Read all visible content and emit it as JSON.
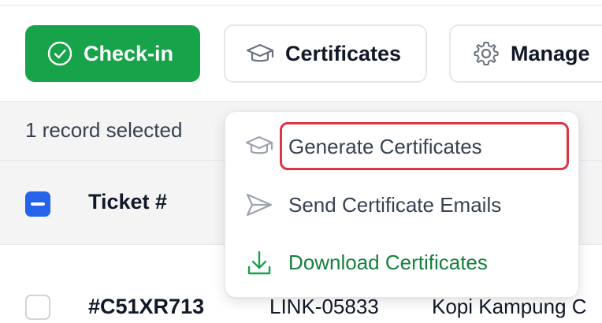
{
  "toolbar": {
    "checkin_label": "Check-in",
    "certificates_label": "Certificates",
    "manage_label": "Manage"
  },
  "selection": {
    "text": "1 record selected"
  },
  "table": {
    "header": {
      "ticket": "Ticket #"
    },
    "rows": [
      {
        "ticket": "#C51XR713",
        "link": "LINK-05833",
        "name": "Kopi Kampung C"
      }
    ]
  },
  "dropdown": {
    "items": [
      {
        "label": "Generate Certificates",
        "icon": "graduation-cap-icon"
      },
      {
        "label": "Send Certificate Emails",
        "icon": "send-icon"
      },
      {
        "label": "Download Certificates",
        "icon": "download-icon"
      }
    ]
  },
  "colors": {
    "primary_green": "#16a34a",
    "download_green": "#15803d",
    "checkbox_blue": "#2563eb",
    "highlight_red": "#dc3545"
  }
}
